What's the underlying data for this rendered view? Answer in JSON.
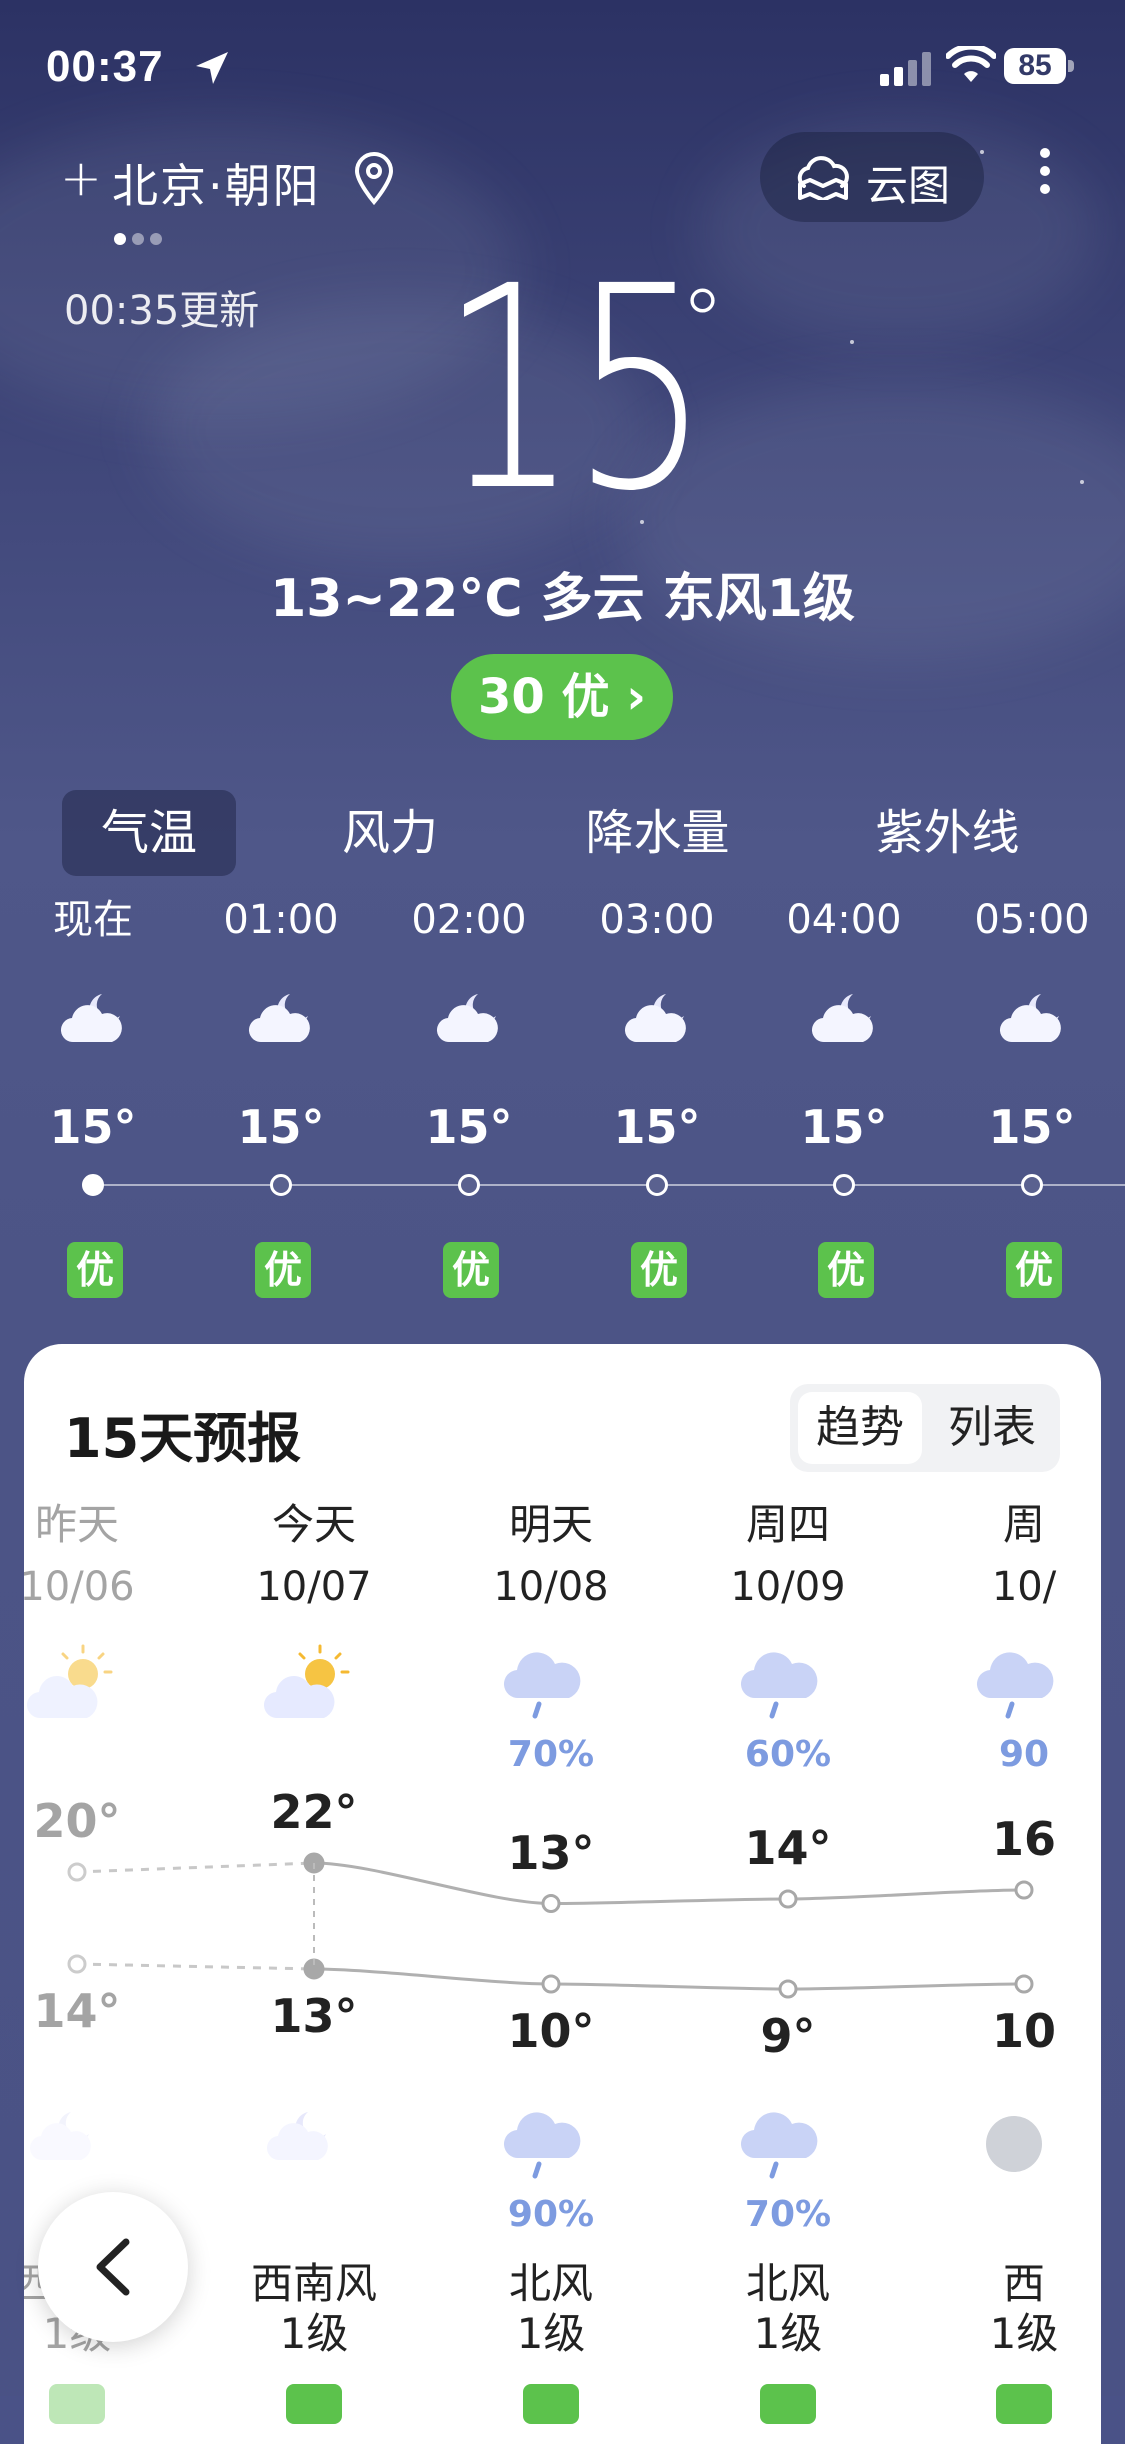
{
  "status": {
    "time": "00:37",
    "battery": "85"
  },
  "header": {
    "city": "北京·朝阳",
    "cloud_map_label": "云图",
    "updated": "00:35更新"
  },
  "current": {
    "temp": "15",
    "summary": "13~22°C 多云 东风1级",
    "aqi_label": "30 优"
  },
  "tabs": [
    "气温",
    "风力",
    "降水量",
    "紫外线"
  ],
  "hourly": [
    {
      "time": "现在",
      "temp": "15°",
      "aqi": "优",
      "icon": "cloudy-night-icon"
    },
    {
      "time": "01:00",
      "temp": "15°",
      "aqi": "优",
      "icon": "cloudy-night-icon"
    },
    {
      "time": "02:00",
      "temp": "15°",
      "aqi": "优",
      "icon": "cloudy-night-icon"
    },
    {
      "time": "03:00",
      "temp": "15°",
      "aqi": "优",
      "icon": "cloudy-night-icon"
    },
    {
      "time": "04:00",
      "temp": "15°",
      "aqi": "优",
      "icon": "cloudy-night-icon"
    },
    {
      "time": "05:00",
      "temp": "15°",
      "aqi": "优",
      "icon": "cloudy-night-icon"
    }
  ],
  "forecast": {
    "title": "15天预报",
    "toggle": {
      "trend": "趋势",
      "list": "列表"
    },
    "days": [
      {
        "name": "昨天",
        "date": "10/06",
        "day_icon": "partly-sunny-icon",
        "day_pop": "",
        "high": "20°",
        "low": "14°",
        "night_icon": "cloudy-night-icon",
        "night_pop": "",
        "wind_dir": "西南风",
        "wind_level": "1级"
      },
      {
        "name": "今天",
        "date": "10/07",
        "day_icon": "partly-sunny-icon",
        "day_pop": "",
        "high": "22°",
        "low": "13°",
        "night_icon": "cloudy-night-icon",
        "night_pop": "",
        "wind_dir": "西南风",
        "wind_level": "1级"
      },
      {
        "name": "明天",
        "date": "10/08",
        "day_icon": "rain-icon",
        "day_pop": "70%",
        "high": "13°",
        "low": "10°",
        "night_icon": "rain-icon",
        "night_pop": "90%",
        "wind_dir": "北风",
        "wind_level": "1级"
      },
      {
        "name": "周四",
        "date": "10/09",
        "day_icon": "rain-icon",
        "day_pop": "60%",
        "high": "14°",
        "low": "9°",
        "night_icon": "rain-icon",
        "night_pop": "70%",
        "wind_dir": "北风",
        "wind_level": "1级"
      },
      {
        "name": "周",
        "date": "10/",
        "day_icon": "rain-icon",
        "day_pop": "90",
        "high": "16",
        "low": "10",
        "night_icon": "cloud-icon",
        "night_pop": "",
        "wind_dir": "西",
        "wind_level": "1级"
      }
    ]
  }
}
